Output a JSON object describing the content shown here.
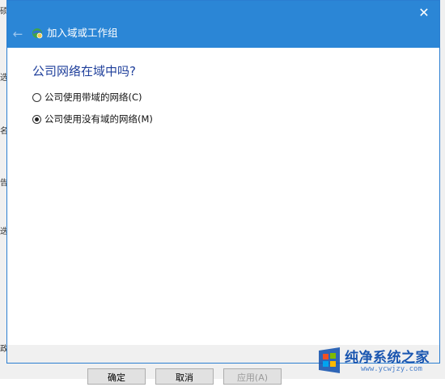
{
  "dialog": {
    "title": "加入域或工作组",
    "question": "公司网络在域中吗?",
    "options": [
      {
        "label": "公司使用带域的网络(C)",
        "selected": false
      },
      {
        "label": "公司使用没有域的网络(M)",
        "selected": true
      }
    ],
    "close_symbol": "✕",
    "back_symbol": "←"
  },
  "background_window": {
    "side_fragments": [
      "硕",
      "选",
      "名",
      "告",
      "迭",
      "政"
    ],
    "buttons": [
      {
        "label": "确定",
        "enabled": true
      },
      {
        "label": "取消",
        "enabled": true
      },
      {
        "label": "应用(A)",
        "enabled": false
      }
    ]
  },
  "watermark": {
    "text": "纯净系统之家",
    "url": "www.ycwjzy.com"
  },
  "colors": {
    "titlebar": "#2b86d6",
    "heading": "#1f3f9b"
  }
}
